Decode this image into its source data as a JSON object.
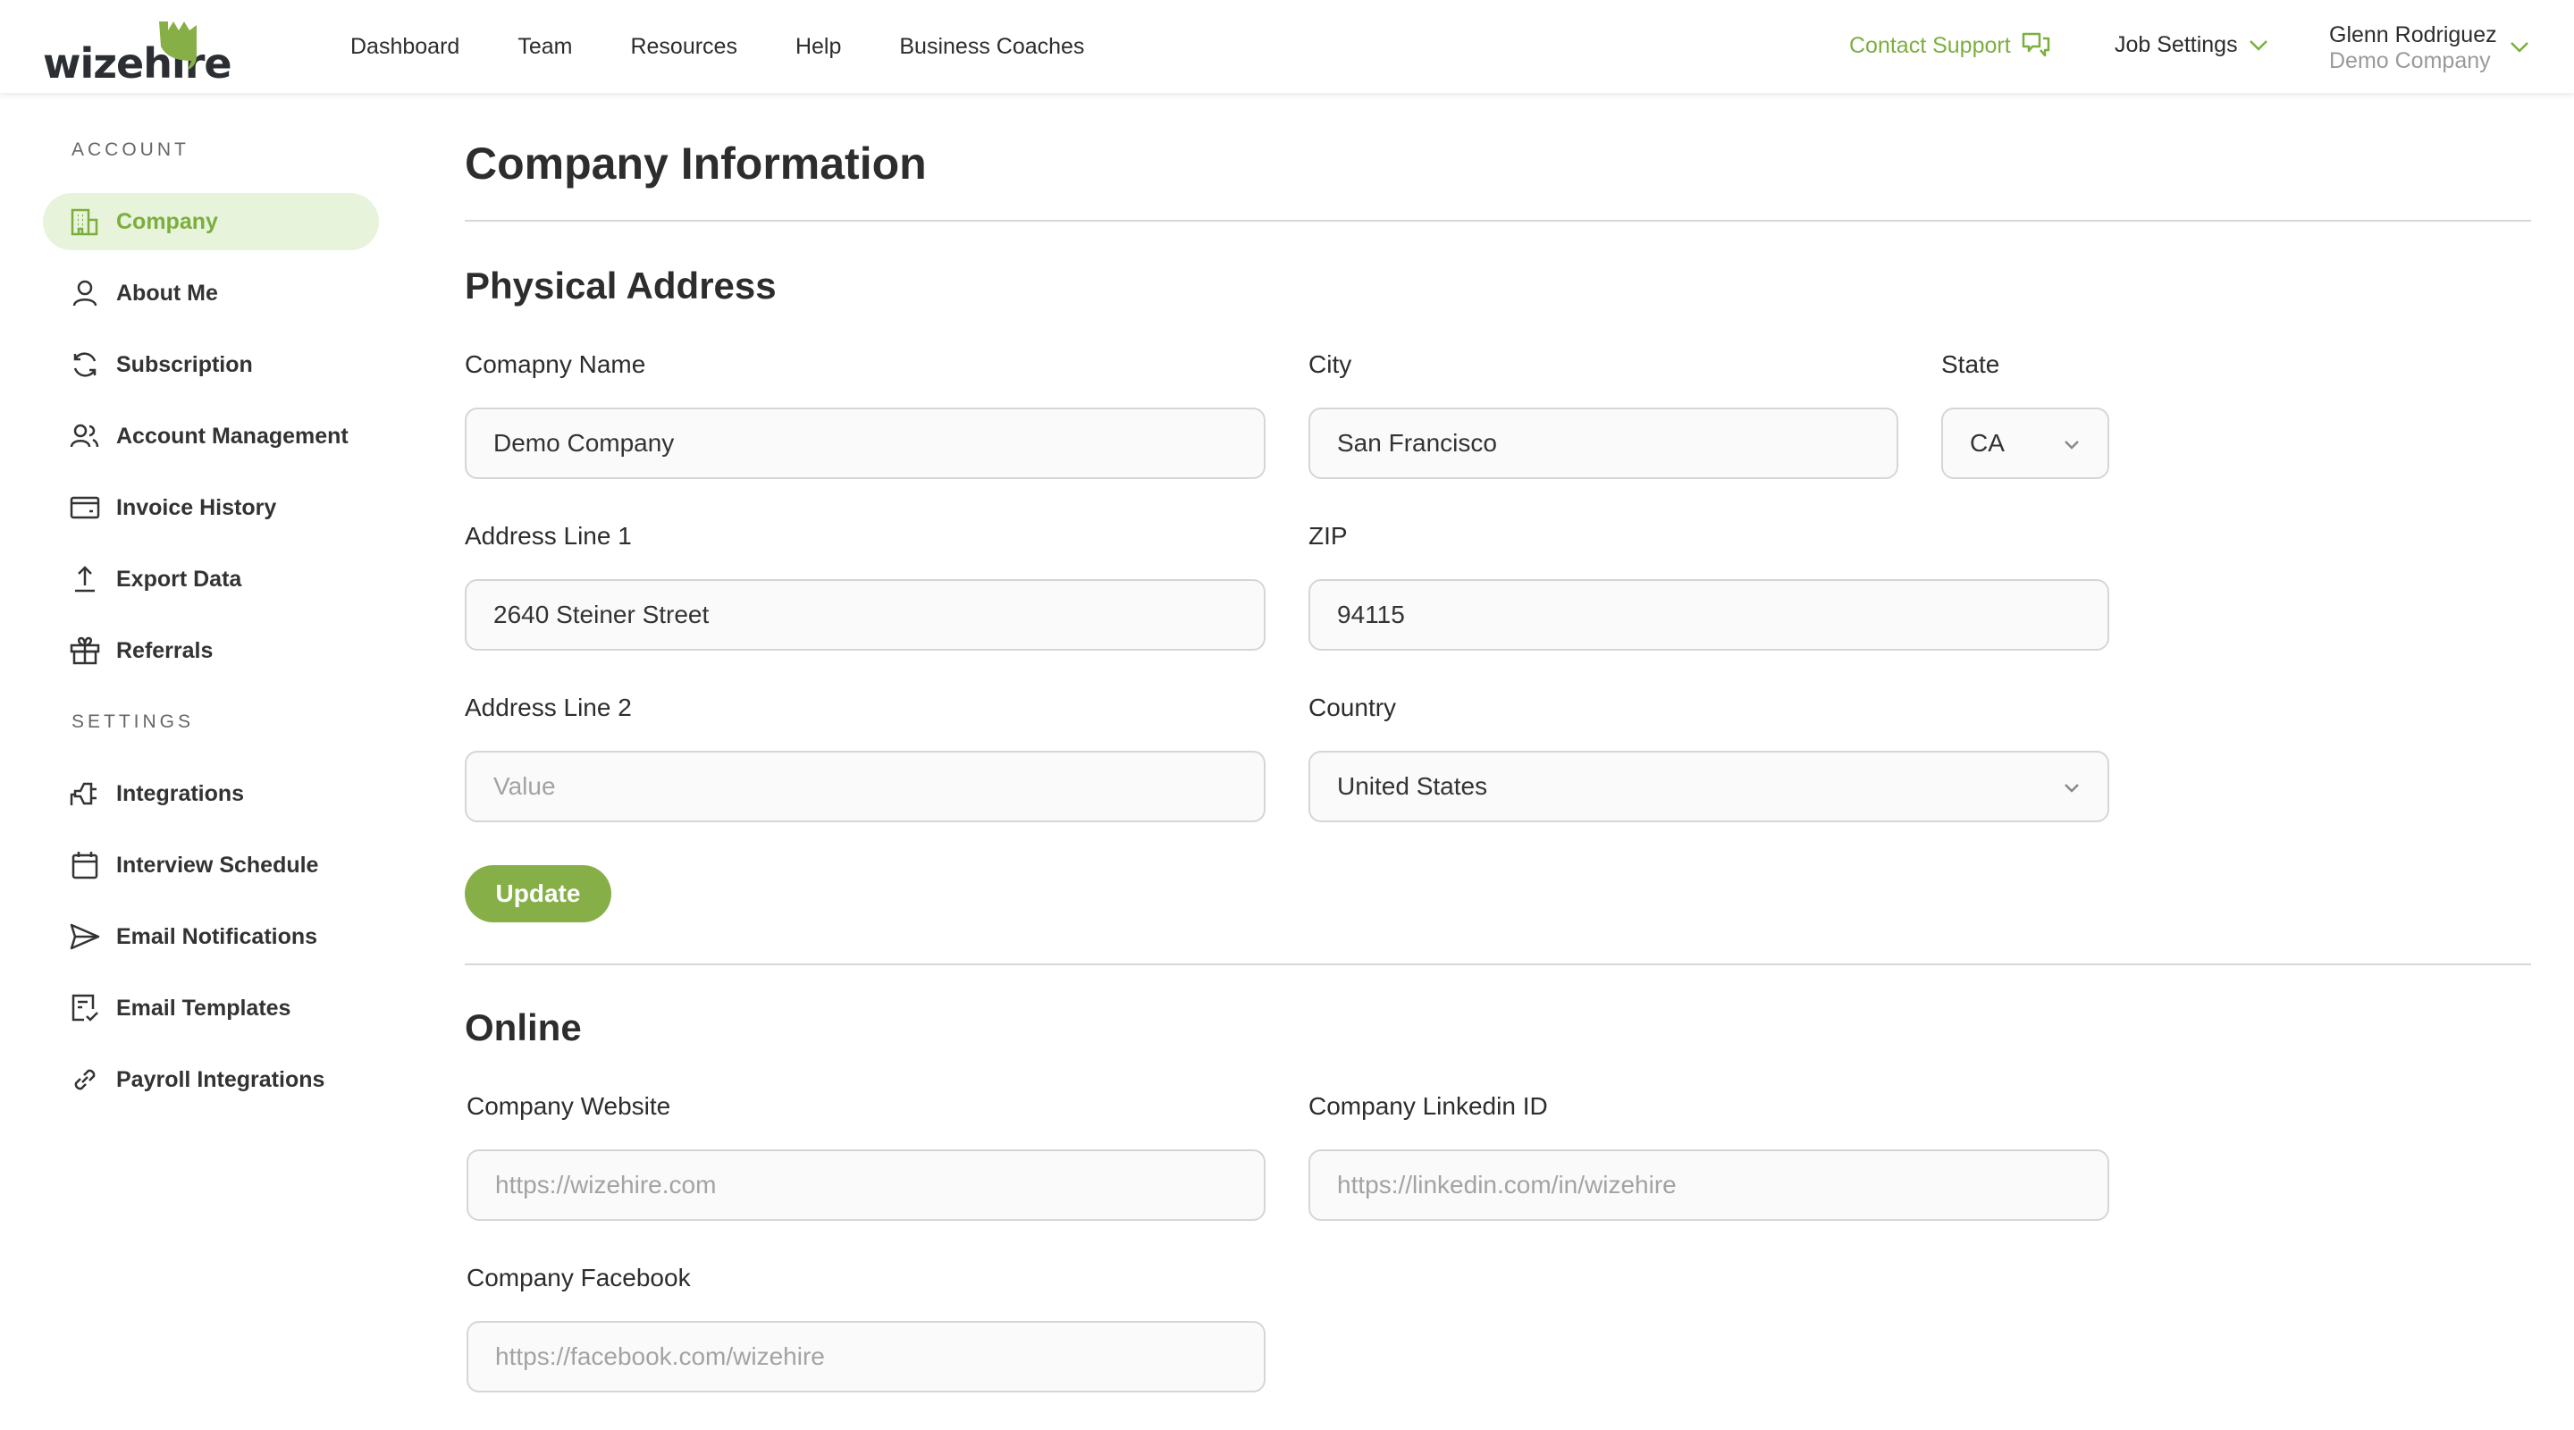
{
  "header": {
    "logo": "wizehire",
    "nav": [
      "Dashboard",
      "Team",
      "Resources",
      "Help",
      "Business Coaches"
    ],
    "contact_support": "Contact Support",
    "job_settings": "Job Settings",
    "user_name": "Glenn Rodriguez",
    "user_company": "Demo Company"
  },
  "sidebar": {
    "account_heading": "ACCOUNT",
    "account_items": [
      {
        "label": "Company",
        "icon": "building-icon",
        "active": true
      },
      {
        "label": "About Me",
        "icon": "user-icon"
      },
      {
        "label": "Subscription",
        "icon": "refresh-icon"
      },
      {
        "label": "Account Management",
        "icon": "users-icon"
      },
      {
        "label": "Invoice History",
        "icon": "credit-card-icon"
      },
      {
        "label": "Export Data",
        "icon": "upload-icon"
      },
      {
        "label": "Referrals",
        "icon": "gift-icon"
      }
    ],
    "settings_heading": "SETTINGS",
    "settings_items": [
      {
        "label": "Integrations",
        "icon": "plug-icon"
      },
      {
        "label": "Interview Schedule",
        "icon": "calendar-icon"
      },
      {
        "label": "Email Notifications",
        "icon": "send-icon"
      },
      {
        "label": "Email Templates",
        "icon": "document-check-icon"
      },
      {
        "label": "Payroll Integrations",
        "icon": "link-icon"
      }
    ]
  },
  "main": {
    "title": "Company Information",
    "physical": {
      "title": "Physical Address",
      "company_name": {
        "label": "Comapny Name",
        "value": "Demo Company"
      },
      "city": {
        "label": "City",
        "value": "San Francisco"
      },
      "state": {
        "label": "State",
        "value": "CA"
      },
      "address1": {
        "label": "Address Line 1",
        "value": "2640 Steiner Street"
      },
      "zip": {
        "label": "ZIP",
        "value": "94115"
      },
      "address2": {
        "label": "Address Line 2",
        "placeholder": "Value"
      },
      "country": {
        "label": "Country",
        "value": "United States"
      },
      "update": "Update"
    },
    "online": {
      "title": "Online",
      "website": {
        "label": "Company Website",
        "placeholder": "https://wizehire.com"
      },
      "linkedin": {
        "label": "Company Linkedin ID",
        "placeholder": "https://linkedin.com/in/wizehire"
      },
      "facebook": {
        "label": "Company Facebook",
        "placeholder": "https://facebook.com/wizehire"
      }
    }
  },
  "colors": {
    "accent": "#7cae3e",
    "button": "#86b047",
    "active_bg": "#e8f3dc"
  }
}
